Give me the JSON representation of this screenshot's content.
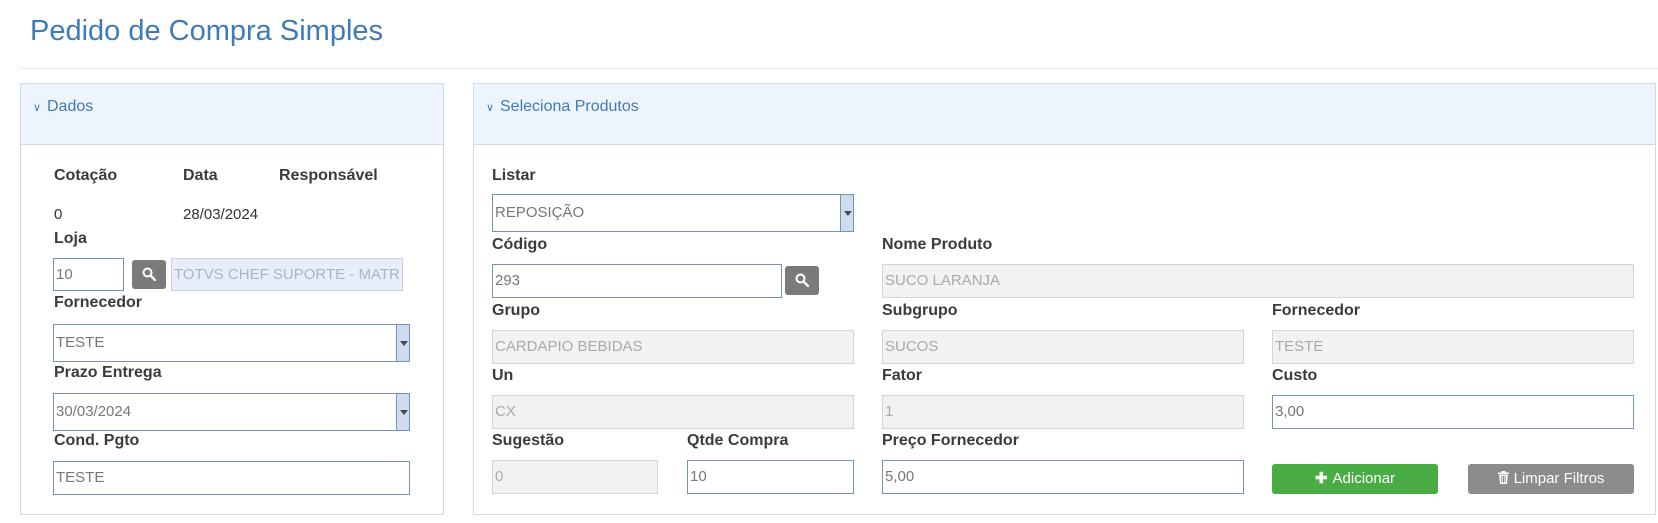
{
  "page": {
    "title": "Pedido de Compra Simples"
  },
  "dados": {
    "header": "Dados",
    "cotacao_label": "Cotação",
    "data_label": "Data",
    "responsavel_label": "Responsável",
    "cotacao_value": "0",
    "data_value": "28/03/2024",
    "loja_label": "Loja",
    "loja_value": "10",
    "loja_name": "TOTVS CHEF SUPORTE - MATR",
    "fornecedor_label": "Fornecedor",
    "fornecedor_value": "TESTE",
    "prazo_label": "Prazo Entrega",
    "prazo_value": "30/03/2024",
    "cond_label": "Cond. Pgto",
    "cond_value": "TESTE"
  },
  "produtos": {
    "header": "Seleciona Produtos",
    "listar_label": "Listar",
    "listar_value": "REPOSIÇÃO",
    "codigo_label": "Código",
    "codigo_value": "293",
    "nome_label": "Nome Produto",
    "nome_value": "SUCO LARANJA",
    "grupo_label": "Grupo",
    "grupo_value": "CARDAPIO BEBIDAS",
    "subgrupo_label": "Subgrupo",
    "subgrupo_value": "SUCOS",
    "fornecedor_label": "Fornecedor",
    "fornecedor_value": "TESTE",
    "un_label": "Un",
    "un_value": "CX",
    "fator_label": "Fator",
    "fator_value": "1",
    "custo_label": "Custo",
    "custo_value": "3,00",
    "sugestao_label": "Sugestão",
    "sugestao_value": "0",
    "qtde_label": "Qtde Compra",
    "qtde_value": "10",
    "preco_label": "Preço Fornecedor",
    "preco_value": "5,00",
    "add_button": "Adicionar",
    "clear_button": "Limpar Filtros"
  },
  "icons": {
    "chevron": "chevron-down-icon",
    "search": "search-icon",
    "plus": "plus-icon",
    "trash": "trash-icon",
    "dropdown": "caret-down-icon"
  },
  "colors": {
    "accent": "#3f7bb6",
    "add_button": "#4aac44",
    "clear_button": "#8c8c8c"
  }
}
